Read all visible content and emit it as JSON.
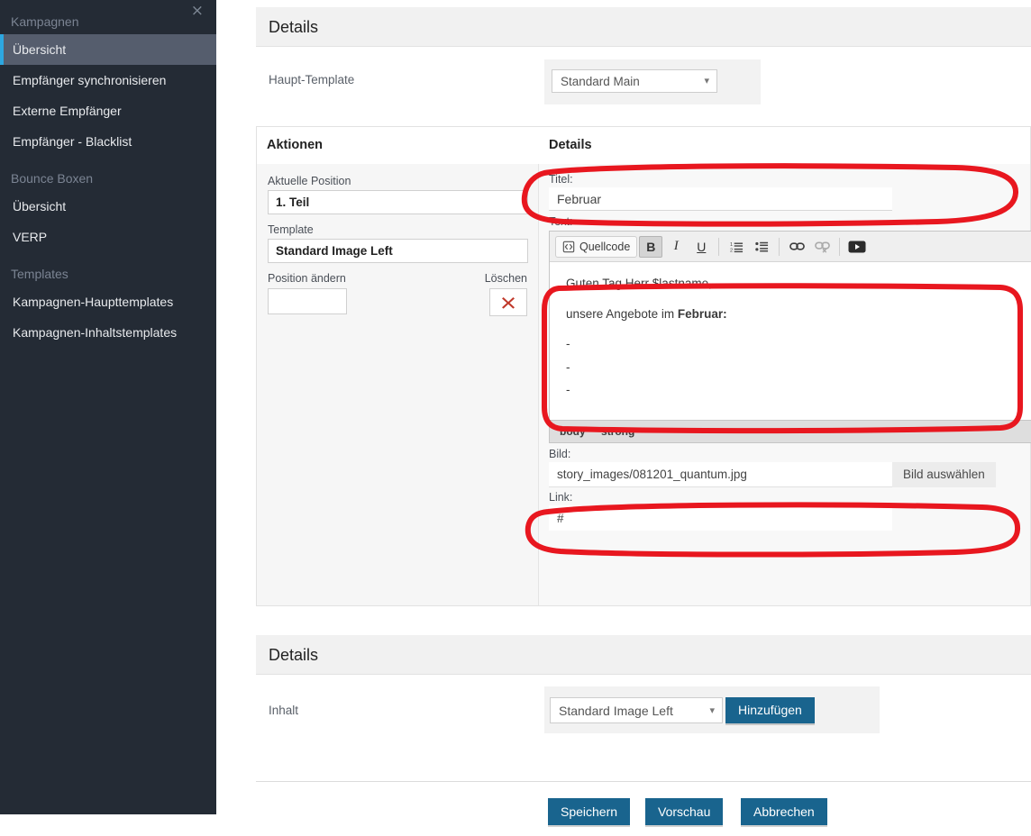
{
  "sidebar": {
    "close_label": "×",
    "groups": [
      {
        "title": "Kampagnen",
        "items": [
          {
            "label": "Übersicht",
            "active": true
          },
          {
            "label": "Empfänger synchronisieren",
            "active": false
          },
          {
            "label": "Externe Empfänger",
            "active": false
          },
          {
            "label": "Empfänger - Blacklist",
            "active": false
          }
        ]
      },
      {
        "title": "Bounce Boxen",
        "items": [
          {
            "label": "Übersicht",
            "active": false
          },
          {
            "label": "VERP",
            "active": false
          }
        ]
      },
      {
        "title": "Templates",
        "items": [
          {
            "label": "Kampagnen-Haupttemplates",
            "active": false
          },
          {
            "label": "Kampagnen-Inhaltstemplates",
            "active": false
          }
        ]
      }
    ]
  },
  "top_panel": {
    "title": "Details",
    "haupt_template_label": "Haupt-Template",
    "haupt_template_value": "Standard Main",
    "haupt_template_options": [
      "Standard Main"
    ]
  },
  "split_panel": {
    "left_header": "Aktionen",
    "right_header": "Details",
    "aktuelle_position_label": "Aktuelle Position",
    "aktuelle_position_value": "1. Teil",
    "template_label": "Template",
    "template_value": "Standard Image Left",
    "position_aendern_label": "Position ändern",
    "position_aendern_value": "",
    "loeschen_label": "Löschen",
    "loeschen_icon": "red-x-icon",
    "titel_label": "Titel:",
    "titel_value": "Februar",
    "text_label": "Text:",
    "toolbar": {
      "quellcode_label": "Quellcode",
      "bold_label": "B",
      "italic_label": "I",
      "underline_label": "U",
      "ordered_list_icon": "numbered-list-icon",
      "unordered_list_icon": "bullet-list-icon",
      "link_icon": "link-icon",
      "unlink_icon": "unlink-icon",
      "video_icon": "video-icon"
    },
    "editor_content": {
      "greeting": "Guten Tag Herr $lastname,",
      "intro_prefix": "unsere Angebote im ",
      "intro_bold": "Februar:",
      "bullets": [
        "-",
        "-",
        "-"
      ]
    },
    "status_path": [
      "body",
      "strong"
    ],
    "bild_label": "Bild:",
    "bild_value": "story_images/081201_quantum.jpg",
    "bild_button": "Bild auswählen",
    "link_label": "Link:",
    "link_value": "#"
  },
  "bottom_panel": {
    "title": "Details",
    "inhalt_label": "Inhalt",
    "inhalt_value": "Standard Image Left",
    "inhalt_options": [
      "Standard Image Left"
    ],
    "hinzufuegen_label": "Hinzufügen"
  },
  "footer": {
    "save_label": "Speichern",
    "preview_label": "Vorschau",
    "cancel_label": "Abbrechen"
  },
  "colors": {
    "sidebar_bg": "#242b35",
    "sidebar_active_bg": "#555d6d",
    "sidebar_accent": "#2da7e0",
    "button_blue": "#19648e",
    "annotation_red": "#e8171f",
    "panel_head_bg": "#f1f1f1"
  }
}
